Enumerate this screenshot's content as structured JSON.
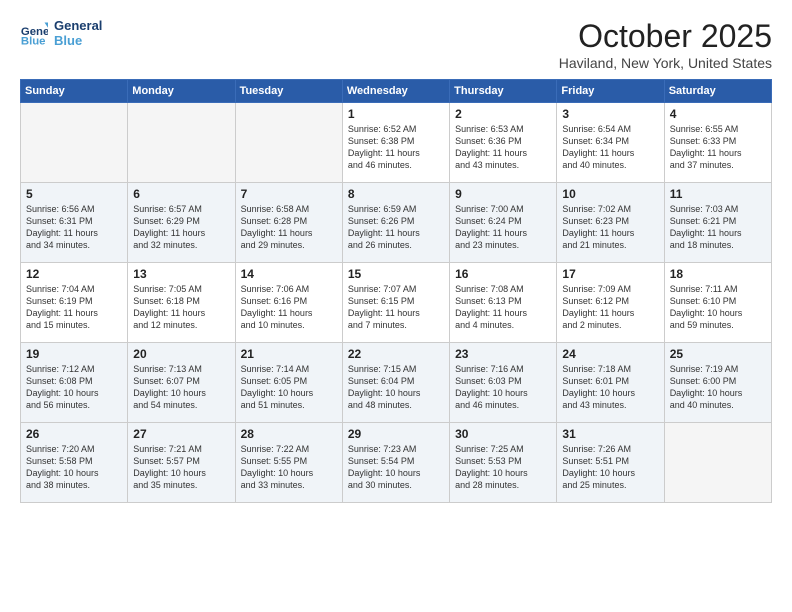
{
  "logo": {
    "line1": "General",
    "line2": "Blue"
  },
  "title": "October 2025",
  "location": "Haviland, New York, United States",
  "weekdays": [
    "Sunday",
    "Monday",
    "Tuesday",
    "Wednesday",
    "Thursday",
    "Friday",
    "Saturday"
  ],
  "weeks": [
    [
      {
        "day": "",
        "info": ""
      },
      {
        "day": "",
        "info": ""
      },
      {
        "day": "",
        "info": ""
      },
      {
        "day": "1",
        "info": "Sunrise: 6:52 AM\nSunset: 6:38 PM\nDaylight: 11 hours\nand 46 minutes."
      },
      {
        "day": "2",
        "info": "Sunrise: 6:53 AM\nSunset: 6:36 PM\nDaylight: 11 hours\nand 43 minutes."
      },
      {
        "day": "3",
        "info": "Sunrise: 6:54 AM\nSunset: 6:34 PM\nDaylight: 11 hours\nand 40 minutes."
      },
      {
        "day": "4",
        "info": "Sunrise: 6:55 AM\nSunset: 6:33 PM\nDaylight: 11 hours\nand 37 minutes."
      }
    ],
    [
      {
        "day": "5",
        "info": "Sunrise: 6:56 AM\nSunset: 6:31 PM\nDaylight: 11 hours\nand 34 minutes."
      },
      {
        "day": "6",
        "info": "Sunrise: 6:57 AM\nSunset: 6:29 PM\nDaylight: 11 hours\nand 32 minutes."
      },
      {
        "day": "7",
        "info": "Sunrise: 6:58 AM\nSunset: 6:28 PM\nDaylight: 11 hours\nand 29 minutes."
      },
      {
        "day": "8",
        "info": "Sunrise: 6:59 AM\nSunset: 6:26 PM\nDaylight: 11 hours\nand 26 minutes."
      },
      {
        "day": "9",
        "info": "Sunrise: 7:00 AM\nSunset: 6:24 PM\nDaylight: 11 hours\nand 23 minutes."
      },
      {
        "day": "10",
        "info": "Sunrise: 7:02 AM\nSunset: 6:23 PM\nDaylight: 11 hours\nand 21 minutes."
      },
      {
        "day": "11",
        "info": "Sunrise: 7:03 AM\nSunset: 6:21 PM\nDaylight: 11 hours\nand 18 minutes."
      }
    ],
    [
      {
        "day": "12",
        "info": "Sunrise: 7:04 AM\nSunset: 6:19 PM\nDaylight: 11 hours\nand 15 minutes."
      },
      {
        "day": "13",
        "info": "Sunrise: 7:05 AM\nSunset: 6:18 PM\nDaylight: 11 hours\nand 12 minutes."
      },
      {
        "day": "14",
        "info": "Sunrise: 7:06 AM\nSunset: 6:16 PM\nDaylight: 11 hours\nand 10 minutes."
      },
      {
        "day": "15",
        "info": "Sunrise: 7:07 AM\nSunset: 6:15 PM\nDaylight: 11 hours\nand 7 minutes."
      },
      {
        "day": "16",
        "info": "Sunrise: 7:08 AM\nSunset: 6:13 PM\nDaylight: 11 hours\nand 4 minutes."
      },
      {
        "day": "17",
        "info": "Sunrise: 7:09 AM\nSunset: 6:12 PM\nDaylight: 11 hours\nand 2 minutes."
      },
      {
        "day": "18",
        "info": "Sunrise: 7:11 AM\nSunset: 6:10 PM\nDaylight: 10 hours\nand 59 minutes."
      }
    ],
    [
      {
        "day": "19",
        "info": "Sunrise: 7:12 AM\nSunset: 6:08 PM\nDaylight: 10 hours\nand 56 minutes."
      },
      {
        "day": "20",
        "info": "Sunrise: 7:13 AM\nSunset: 6:07 PM\nDaylight: 10 hours\nand 54 minutes."
      },
      {
        "day": "21",
        "info": "Sunrise: 7:14 AM\nSunset: 6:05 PM\nDaylight: 10 hours\nand 51 minutes."
      },
      {
        "day": "22",
        "info": "Sunrise: 7:15 AM\nSunset: 6:04 PM\nDaylight: 10 hours\nand 48 minutes."
      },
      {
        "day": "23",
        "info": "Sunrise: 7:16 AM\nSunset: 6:03 PM\nDaylight: 10 hours\nand 46 minutes."
      },
      {
        "day": "24",
        "info": "Sunrise: 7:18 AM\nSunset: 6:01 PM\nDaylight: 10 hours\nand 43 minutes."
      },
      {
        "day": "25",
        "info": "Sunrise: 7:19 AM\nSunset: 6:00 PM\nDaylight: 10 hours\nand 40 minutes."
      }
    ],
    [
      {
        "day": "26",
        "info": "Sunrise: 7:20 AM\nSunset: 5:58 PM\nDaylight: 10 hours\nand 38 minutes."
      },
      {
        "day": "27",
        "info": "Sunrise: 7:21 AM\nSunset: 5:57 PM\nDaylight: 10 hours\nand 35 minutes."
      },
      {
        "day": "28",
        "info": "Sunrise: 7:22 AM\nSunset: 5:55 PM\nDaylight: 10 hours\nand 33 minutes."
      },
      {
        "day": "29",
        "info": "Sunrise: 7:23 AM\nSunset: 5:54 PM\nDaylight: 10 hours\nand 30 minutes."
      },
      {
        "day": "30",
        "info": "Sunrise: 7:25 AM\nSunset: 5:53 PM\nDaylight: 10 hours\nand 28 minutes."
      },
      {
        "day": "31",
        "info": "Sunrise: 7:26 AM\nSunset: 5:51 PM\nDaylight: 10 hours\nand 25 minutes."
      },
      {
        "day": "",
        "info": ""
      }
    ]
  ]
}
